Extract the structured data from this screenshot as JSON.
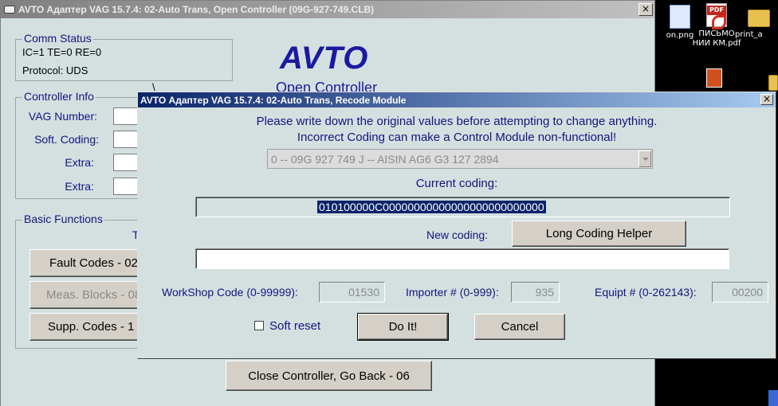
{
  "desktop": {
    "icons": [
      {
        "label": "on.png",
        "icon": "image-file-icon"
      },
      {
        "label": "ПИСЬМО НИИ КМ.pdf",
        "icon": "pdf-file-icon"
      },
      {
        "label": "print_a",
        "icon": "folder-icon"
      }
    ]
  },
  "main_window": {
    "title": "AVTO Адаптер VAG 15.7.4: 02-Auto Trans,  Open Controller (09G-927-749.CLB)",
    "close_label": "×",
    "logo": "AVTO",
    "subtitle": "Open Controller",
    "comm_status": {
      "label": "Comm Status",
      "counters": "IC=1  TE=0   RE=0",
      "protocol": "Protocol: UDS",
      "mark": "\\"
    },
    "controller_info": {
      "label": "Controller Info",
      "vag_number": "VAG Number:",
      "soft_coding": "Soft. Coding:",
      "extra1": "Extra:",
      "extra2": "Extra:"
    },
    "basic_functions": {
      "label": "Basic Functions",
      "t_fragment": "T",
      "fault_codes": "Fault Codes - 02",
      "meas_blocks": "Meas. Blocks - 08",
      "supp_codes": "Supp. Codes - 1"
    },
    "close_controller": "Close Controller, Go Back - 06"
  },
  "dialog": {
    "title": "AVTO Адаптер VAG 15.7.4: 02-Auto Trans,  Recode Module",
    "close_label": "×",
    "warning_line1": "Please write down the original values before attempting to change anything.",
    "warning_line2": "Incorrect Coding can make a Control Module non-functional!",
    "module_select": "0 -- 09G 927 749 J -- AISIN AG6 G3  127 2894",
    "current_coding_label": "Current coding:",
    "current_coding_value": "010100000C00000000000000000000000000",
    "new_coding_label": "New coding:",
    "long_coding_helper": "Long Coding Helper",
    "new_coding_value": "",
    "workshop_label": "WorkShop Code (0-99999):",
    "workshop_value": "01530",
    "importer_label": "Importer # (0-999):",
    "importer_value": "935",
    "equipt_label": "Equipt # (0-262143):",
    "equipt_value": "00200",
    "soft_reset_label": "Soft reset",
    "soft_reset_checked": false,
    "do_it": "Do It!",
    "cancel": "Cancel"
  }
}
